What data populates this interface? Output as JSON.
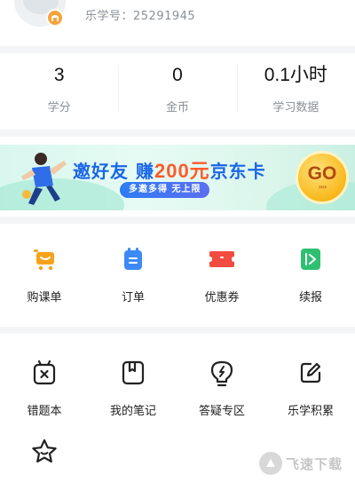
{
  "profile": {
    "student_id": "乐学号：25291945",
    "level_badge_icon": "level-badge-icon"
  },
  "stats": [
    {
      "value": "3",
      "label": "学分"
    },
    {
      "value": "0",
      "label": "金币"
    },
    {
      "value": "0.1小时",
      "label": "学习数据"
    }
  ],
  "banner": {
    "title_prefix": "邀好友",
    "title_earn": "赚",
    "title_amount": "200元",
    "title_suffix": "京东卡",
    "subtitle": "多邀多得 无上限",
    "go_label": "GO",
    "go_arrows": "››››"
  },
  "orders_grid": [
    {
      "label": "购课单",
      "icon": "cart-icon",
      "color": "#f7a21b"
    },
    {
      "label": "订单",
      "icon": "order-icon",
      "color": "#3d8af7"
    },
    {
      "label": "优惠券",
      "icon": "coupon-icon",
      "color": "#f24b3f"
    },
    {
      "label": "续报",
      "icon": "renew-icon",
      "color": "#2fbf71"
    }
  ],
  "tools_grid": [
    {
      "label": "错题本",
      "icon": "wrong-questions-icon"
    },
    {
      "label": "我的笔记",
      "icon": "notes-icon"
    },
    {
      "label": "答疑专区",
      "icon": "qa-bulb-icon"
    },
    {
      "label": "乐学积累",
      "icon": "accumulate-edit-icon"
    }
  ],
  "tools_grid_row2": [
    {
      "label": "",
      "icon": "star-face-icon"
    }
  ],
  "watermark": {
    "text": "飞速下载"
  }
}
